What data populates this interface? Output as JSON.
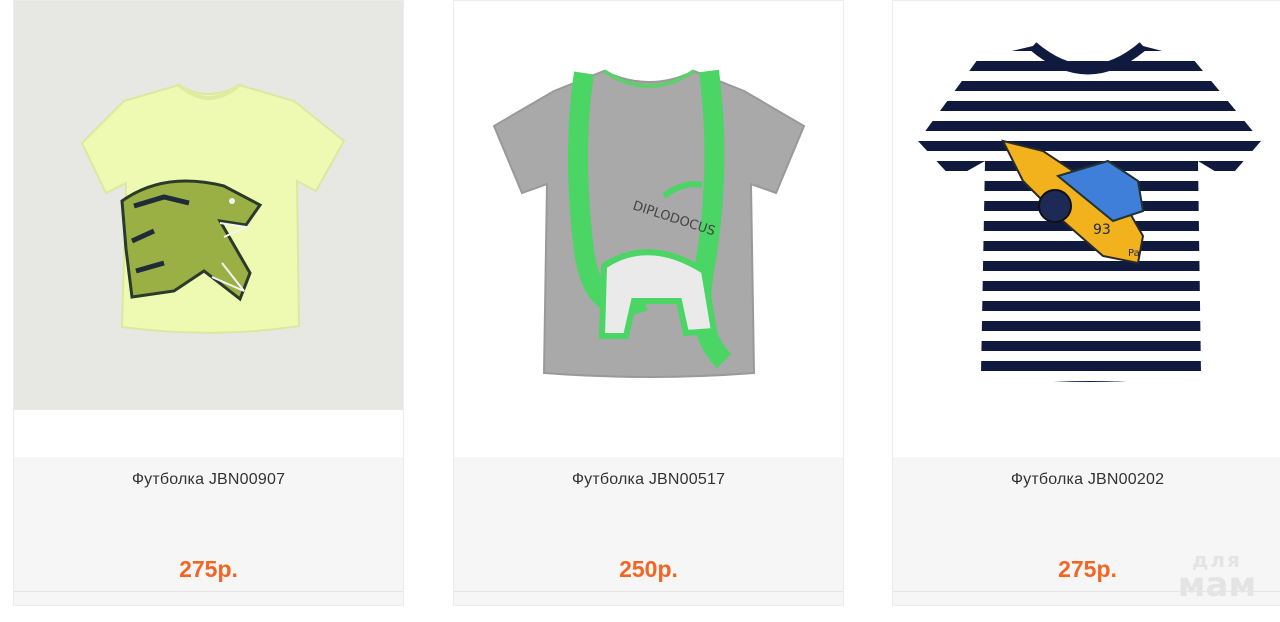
{
  "products": [
    {
      "title": "Футболка JBN00907",
      "price": "275р.",
      "image": "green-dino-tshirt"
    },
    {
      "title": "Футболка JBN00517",
      "price": "250р.",
      "image": "gray-diplodocus-tshirt"
    },
    {
      "title": "Футболка JBN00202",
      "price": "275р.",
      "image": "striped-airplane-tshirt"
    }
  ],
  "prints": {
    "diplodocus": "DIPLODOCUS",
    "plane_number": "93",
    "plane_tag": "Pa"
  },
  "watermark": {
    "line1": "для",
    "line2": "мам"
  },
  "colors": {
    "price": "#f26522",
    "info_bg": "#f6f6f6",
    "card_border": "#ececec"
  }
}
